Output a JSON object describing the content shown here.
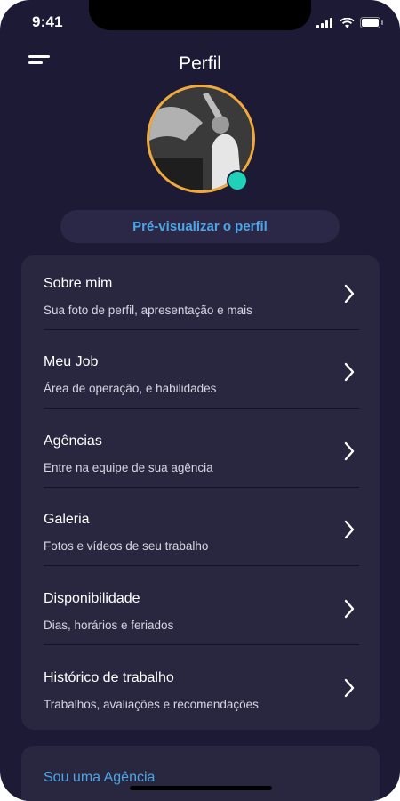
{
  "status_bar": {
    "time": "9:41"
  },
  "header": {
    "title": "Perfil"
  },
  "profile": {
    "preview_label": "Pré-visualizar o perfil"
  },
  "menu_items": [
    {
      "title": "Sobre mim",
      "subtitle": "Sua foto de perfil, apresentação e mais"
    },
    {
      "title": "Meu Job",
      "subtitle": "Área de operação, e habilidades"
    },
    {
      "title": "Agências",
      "subtitle": "Entre na equipe de sua agência"
    },
    {
      "title": "Galeria",
      "subtitle": "Fotos e vídeos de seu trabalho"
    },
    {
      "title": "Disponibilidade",
      "subtitle": "Dias, horários e feriados"
    },
    {
      "title": "Histórico de trabalho",
      "subtitle": "Trabalhos, avaliações e recomendações"
    }
  ],
  "agency": {
    "label": "Sou uma Agência"
  },
  "colors": {
    "background": "#1c1a34",
    "card": "#29273f",
    "accent_link": "#4aa6e6",
    "avatar_ring": "#f2a93b",
    "online": "#1fd1b8"
  }
}
